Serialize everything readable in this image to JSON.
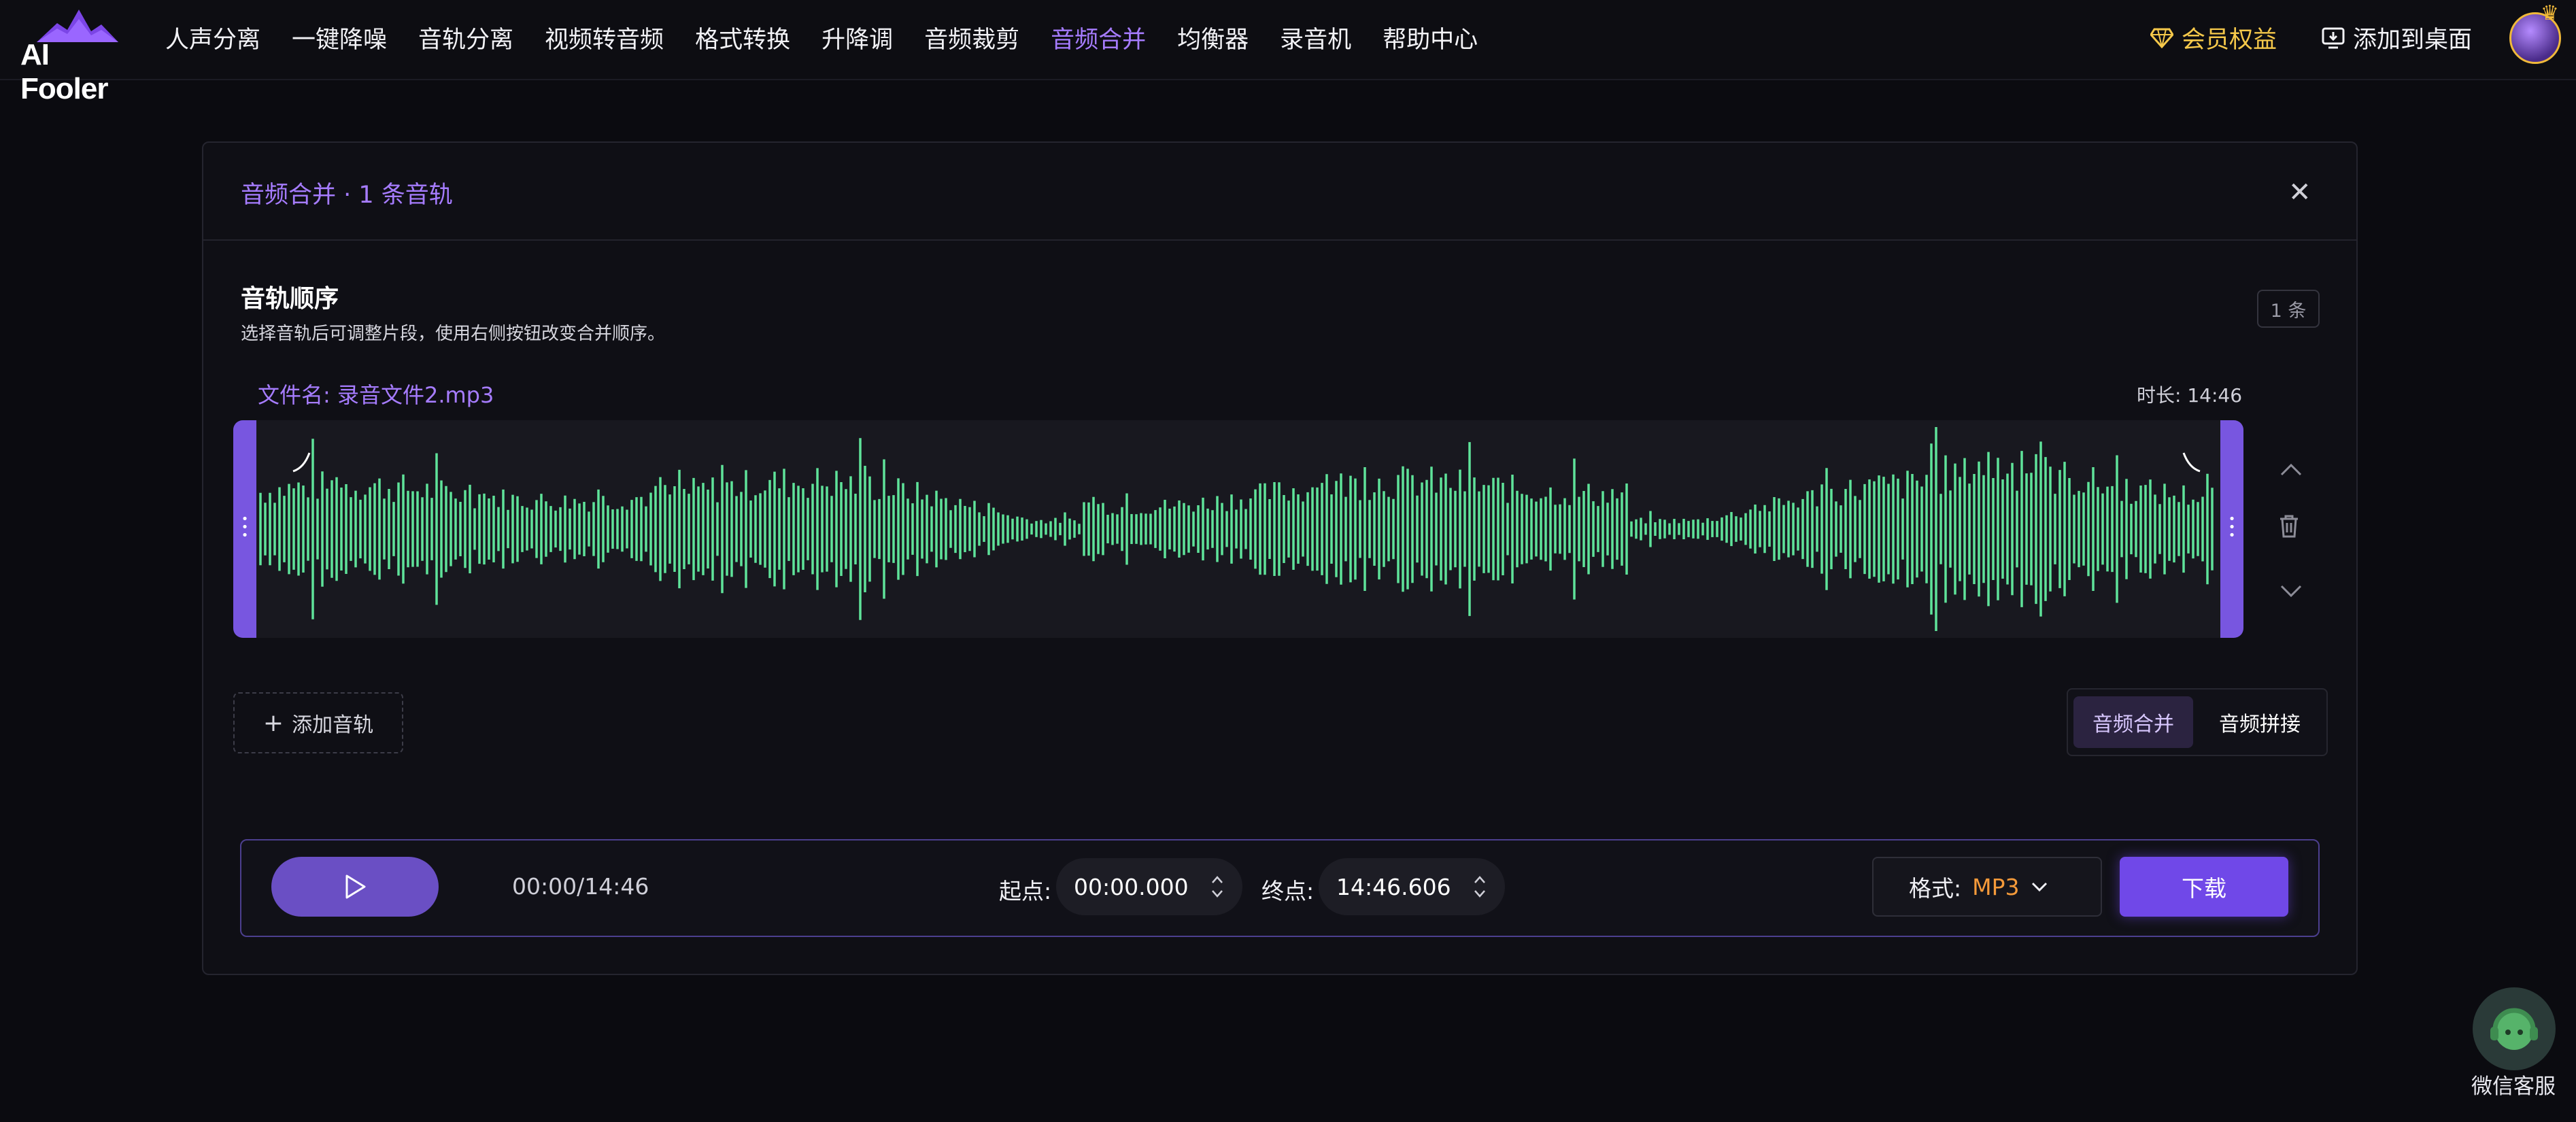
{
  "app": {
    "logo_text": "AI Fooler"
  },
  "nav": {
    "items": [
      "人声分离",
      "一键降噪",
      "音轨分离",
      "视频转音频",
      "格式转换",
      "升降调",
      "音频裁剪",
      "音频合并",
      "均衡器",
      "录音机",
      "帮助中心"
    ],
    "active": "音频合并"
  },
  "header": {
    "member_label": "会员权益",
    "desktop_label": "添加到桌面"
  },
  "panel": {
    "title": "音频合并 · 1 条音轨",
    "section_title": "音轨顺序",
    "section_desc": "选择音轨后可调整片段，使用右侧按钮改变合并顺序。",
    "count_badge": "1 条"
  },
  "track": {
    "file_name": "文件名: 录音文件2.mp3",
    "duration": "时长: 14:46",
    "waveform_color": "#5fe39a",
    "handle_color": "#7856e0"
  },
  "actions": {
    "add_track": "添加音轨"
  },
  "modes": {
    "merge": "音频合并",
    "concat": "音频拼接",
    "selected": "音频合并"
  },
  "player": {
    "time_display": "00:00/14:46",
    "start_label": "起点:",
    "start_value": "00:00.000",
    "end_label": "终点:",
    "end_value": "14:46.606",
    "format_label": "格式:",
    "format_value": "MP3",
    "download_label": "下载"
  },
  "support": {
    "label": "微信客服"
  },
  "colors": {
    "accent": "#a67cff",
    "button": "#7048e8",
    "gold": "#f5c84a",
    "format_value": "#f59a3a"
  }
}
